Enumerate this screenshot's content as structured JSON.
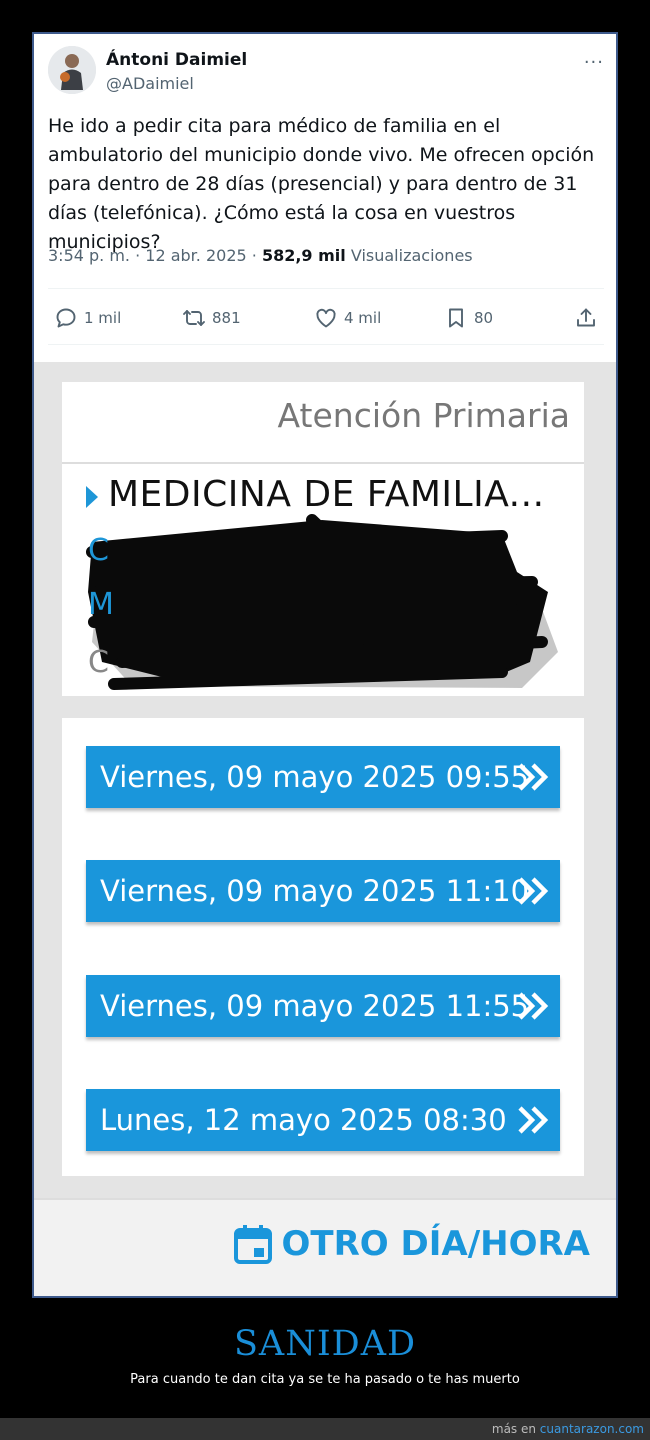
{
  "tweet": {
    "author_name": "Ántoni Daimiel",
    "author_handle": "@ADaimiel",
    "more_glyph": "···",
    "text": "He ido a pedir cita para médico de familia en el ambulatorio del municipio donde vivo. Me ofrecen opción para dentro de 28 días (presencial) y para dentro de 31 días (telefónica). ¿Cómo está la cosa en vuestros municipios?",
    "time": "3:54 p. m. · 12 abr. 2025 · ",
    "views_count": "582,9 mil",
    "views_label": " Visualizaciones",
    "actions": {
      "replies": "1 mil",
      "reposts": "881",
      "likes": "4 mil",
      "bookmarks": "80"
    }
  },
  "screenshot": {
    "section_title": "Atención Primaria",
    "service": "MEDICINA DE FAMILIA...",
    "slots": [
      "Viernes, 09 mayo 2025 09:55",
      "Viernes, 09 mayo 2025 11:10",
      "Viernes, 09 mayo 2025 11:55",
      "Lunes, 12 mayo 2025 08:30"
    ],
    "other_button": "OTRO DÍA/HORA",
    "accent_color": "#1a96db"
  },
  "caption": {
    "title": "SANIDAD",
    "subtitle": "Para cuando te dan cita ya se te ha pasado o te has muerto"
  },
  "footer": {
    "prefix": "más en ",
    "site": "cuantarazon.com"
  }
}
